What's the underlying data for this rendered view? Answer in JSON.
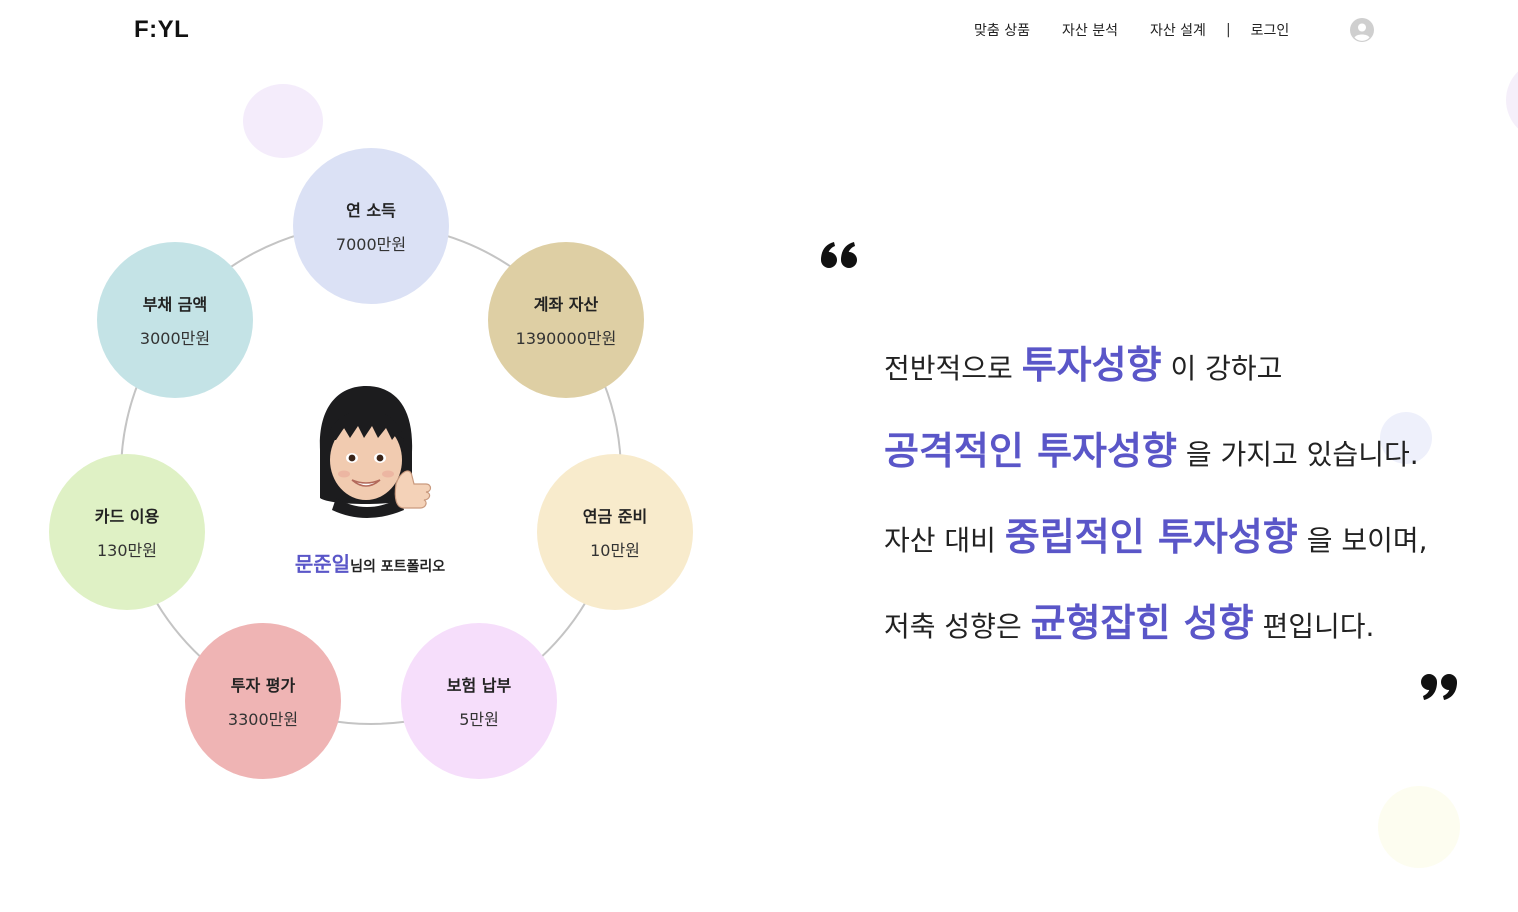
{
  "header": {
    "logo": "F:YL",
    "nav": [
      "맞춤 상품",
      "자산 분석",
      "자산 설계"
    ],
    "separator": "|",
    "login": "로그인"
  },
  "portfolio": {
    "user_name": "문준일",
    "caption_suffix": "님의 포트폴리오",
    "items": [
      {
        "label": "연 소득",
        "value": "7000만원",
        "color": "#dbe1f5"
      },
      {
        "label": "계좌 자산",
        "value": "1390000만원",
        "color": "#decfa4"
      },
      {
        "label": "연금 준비",
        "value": "10만원",
        "color": "#f8ebcc"
      },
      {
        "label": "보험 납부",
        "value": "5만원",
        "color": "#f6defb"
      },
      {
        "label": "투자 평가",
        "value": "3300만원",
        "color": "#efb4b4"
      },
      {
        "label": "카드 이용",
        "value": "130만원",
        "color": "#dff1c5"
      },
      {
        "label": "부채 금액",
        "value": "3000만원",
        "color": "#c4e3e6"
      }
    ]
  },
  "summary": {
    "line1": {
      "pre": "전반적으로",
      "hl": "투자성향",
      "post": "이 강하고"
    },
    "line2": {
      "pre": "",
      "hl": "공격적인 투자성향",
      "post": "을 가지고 있습니다."
    },
    "line3": {
      "pre": "자산 대비",
      "hl": "중립적인 투자성향",
      "post": "을 보이며,"
    },
    "line4": {
      "pre": "저축 성향은",
      "hl": "균형잡힌 성향",
      "post": "편입니다."
    }
  },
  "colors": {
    "accent": "#5a56c8"
  },
  "icons": {
    "profile": "user-circle-icon",
    "quote_open": "quote-open-icon",
    "quote_close": "quote-close-icon"
  }
}
